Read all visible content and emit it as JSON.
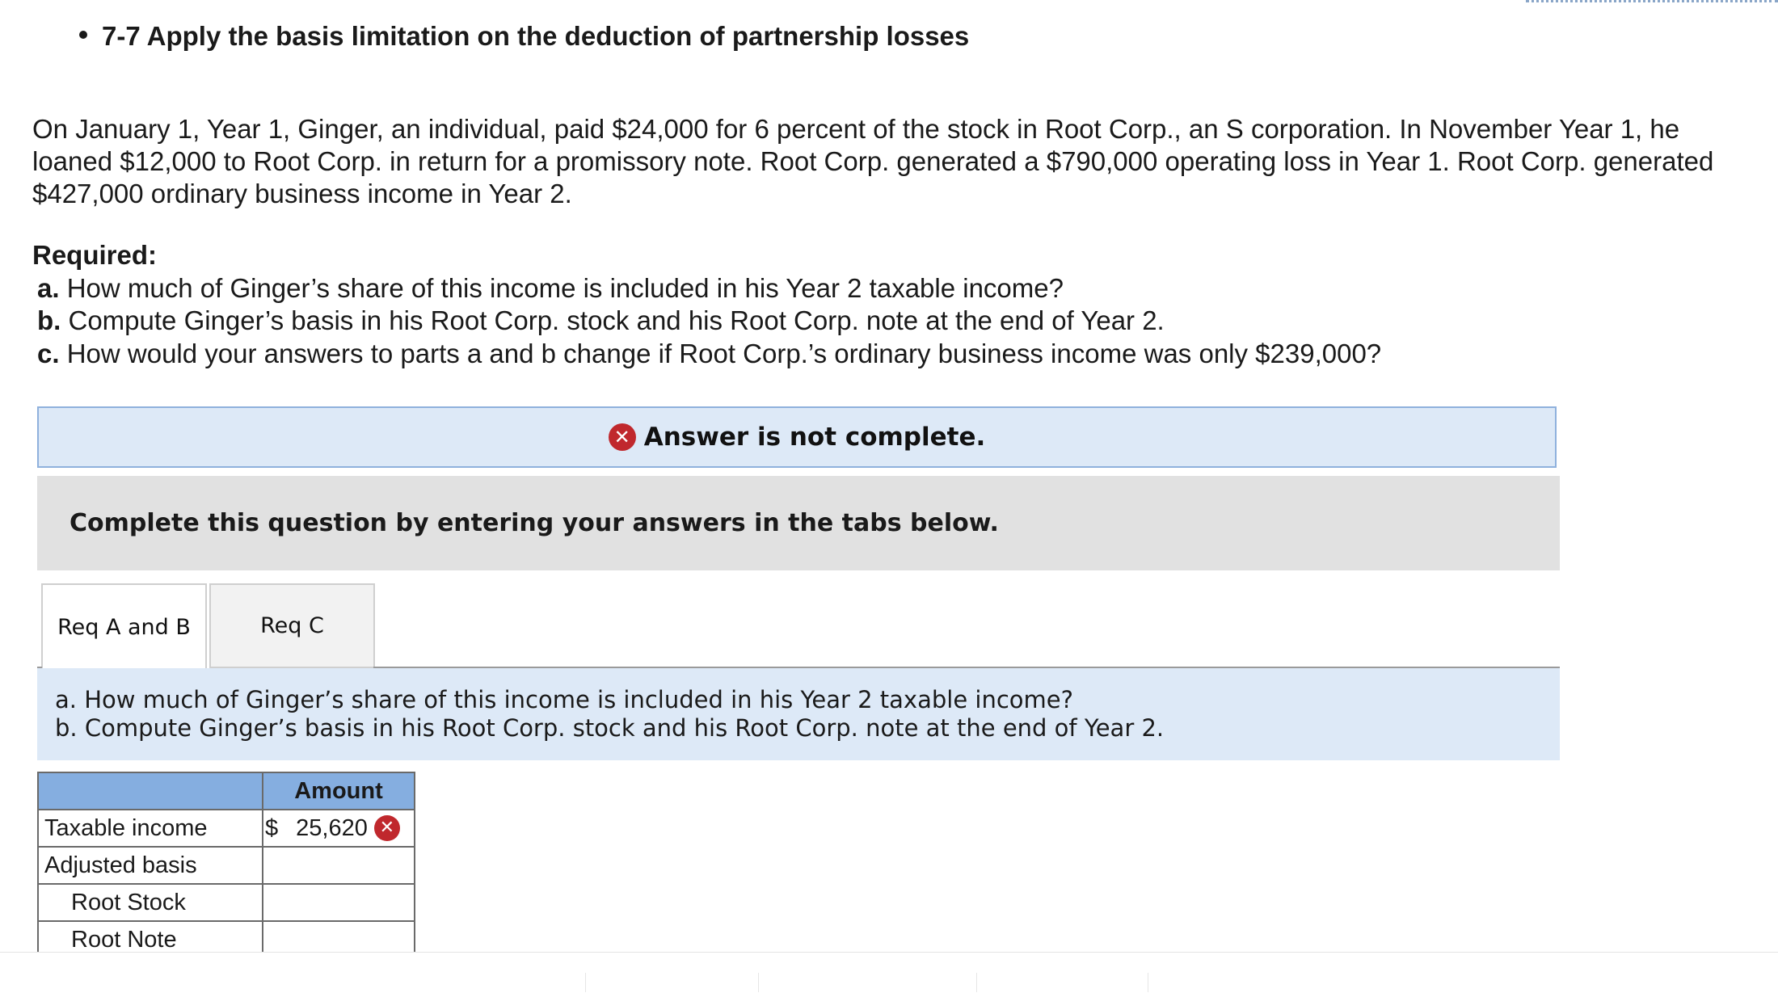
{
  "header": {
    "title": "7-7 Apply the basis limitation on the deduction of partnership losses"
  },
  "problem": {
    "text": "On January 1, Year 1, Ginger, an individual, paid $24,000 for 6 percent of the stock in Root Corp., an S corporation. In November Year 1, he loaned $12,000 to Root Corp. in return for a promissory note. Root Corp. generated a $790,000 operating loss in Year 1. Root Corp. generated $427,000 ordinary business income in Year 2."
  },
  "required": {
    "title": "Required:",
    "items": [
      {
        "label": "a.",
        "text": "How much of Ginger’s share of this income is included in his Year 2 taxable income?"
      },
      {
        "label": "b.",
        "text": "Compute Ginger’s basis in his Root Corp. stock and his Root Corp. note at the end of Year 2."
      },
      {
        "label": "c.",
        "text": "How would your answers to parts a and b change if Root Corp.’s ordinary business income was only $239,000?"
      }
    ]
  },
  "alert": {
    "text": "Answer is not complete.",
    "icon": "x-circle-icon",
    "color": "#c0282d"
  },
  "instruction": {
    "text": "Complete this question by entering your answers in the tabs below."
  },
  "tabs": [
    {
      "label": "Req A and B",
      "active": true
    },
    {
      "label": "Req C",
      "active": false
    }
  ],
  "req_box": {
    "line_a": "a. How much of Ginger’s share of this income is included in his Year 2 taxable income?",
    "line_b": "b. Compute Ginger’s basis in his Root Corp. stock and his Root Corp. note at the end of Year 2."
  },
  "table": {
    "header_amount": "Amount",
    "rows": [
      {
        "label": "Taxable income",
        "currency": "$",
        "value": "25,620",
        "status": "incorrect"
      },
      {
        "label": "Adjusted basis",
        "currency": "",
        "value": ""
      },
      {
        "label": "Root Stock",
        "currency": "",
        "value": ""
      },
      {
        "label": "Root Note",
        "currency": "",
        "value": ""
      }
    ]
  },
  "colors": {
    "alert_bg": "#dde9f7",
    "header_blue": "#85aee0",
    "instruct_gray": "#e1e1e1"
  }
}
